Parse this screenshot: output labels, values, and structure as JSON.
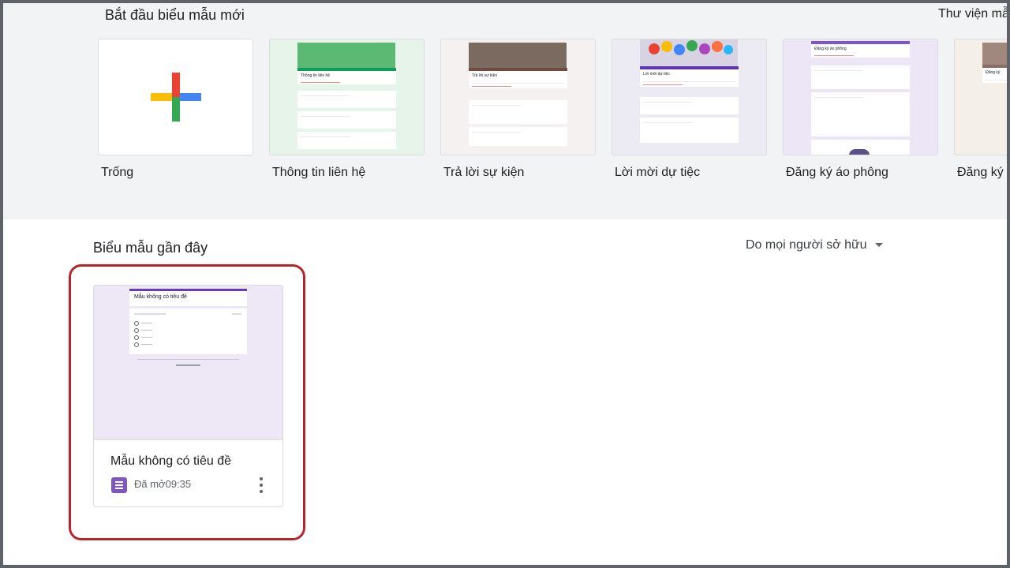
{
  "templates_section": {
    "title": "Bắt đầu biểu mẫu mới",
    "gallery_link": "Thư viện mẫ",
    "items": [
      {
        "label": "Trống"
      },
      {
        "label": "Thông tin liên hệ",
        "preview_title": "Thông tin liên hệ",
        "accent": "#0f9d58",
        "bg": "#e6f4ea"
      },
      {
        "label": "Trả lời sự kiện",
        "preview_title": "Trả lời sự kiện",
        "accent": "#6d4c41",
        "bg": "#f6f1f1"
      },
      {
        "label": "Lời mời dự tiệc",
        "preview_title": "Lời mời dự tiệc",
        "accent": "#5e35b1",
        "bg": "#ecebf3"
      },
      {
        "label": "Đăng ký áo phông",
        "preview_title": "Đăng ký áo phông",
        "accent": "#7e57c2",
        "bg": "#ece6f6"
      },
      {
        "label": "Đăng ký",
        "preview_title": "Đăng ký",
        "accent": "#8d6e63",
        "bg": "#f5efe9"
      }
    ]
  },
  "recent_section": {
    "title": "Biểu mẫu gần đây",
    "owner_filter": "Do mọi người sở hữu"
  },
  "recent_forms": [
    {
      "name": "Mẫu không có tiêu đề",
      "opened_label": "Đã mở",
      "opened_time": "09:35",
      "preview_title": "Mẫu không có tiêu đề",
      "icon": "google-forms-icon"
    }
  ],
  "colors": {
    "forms_purple": "#7e57c2",
    "highlight": "#b3262c",
    "plus_red": "#ea4335",
    "plus_blue": "#4285f4",
    "plus_green": "#34a853",
    "plus_yellow": "#fbbc04"
  }
}
